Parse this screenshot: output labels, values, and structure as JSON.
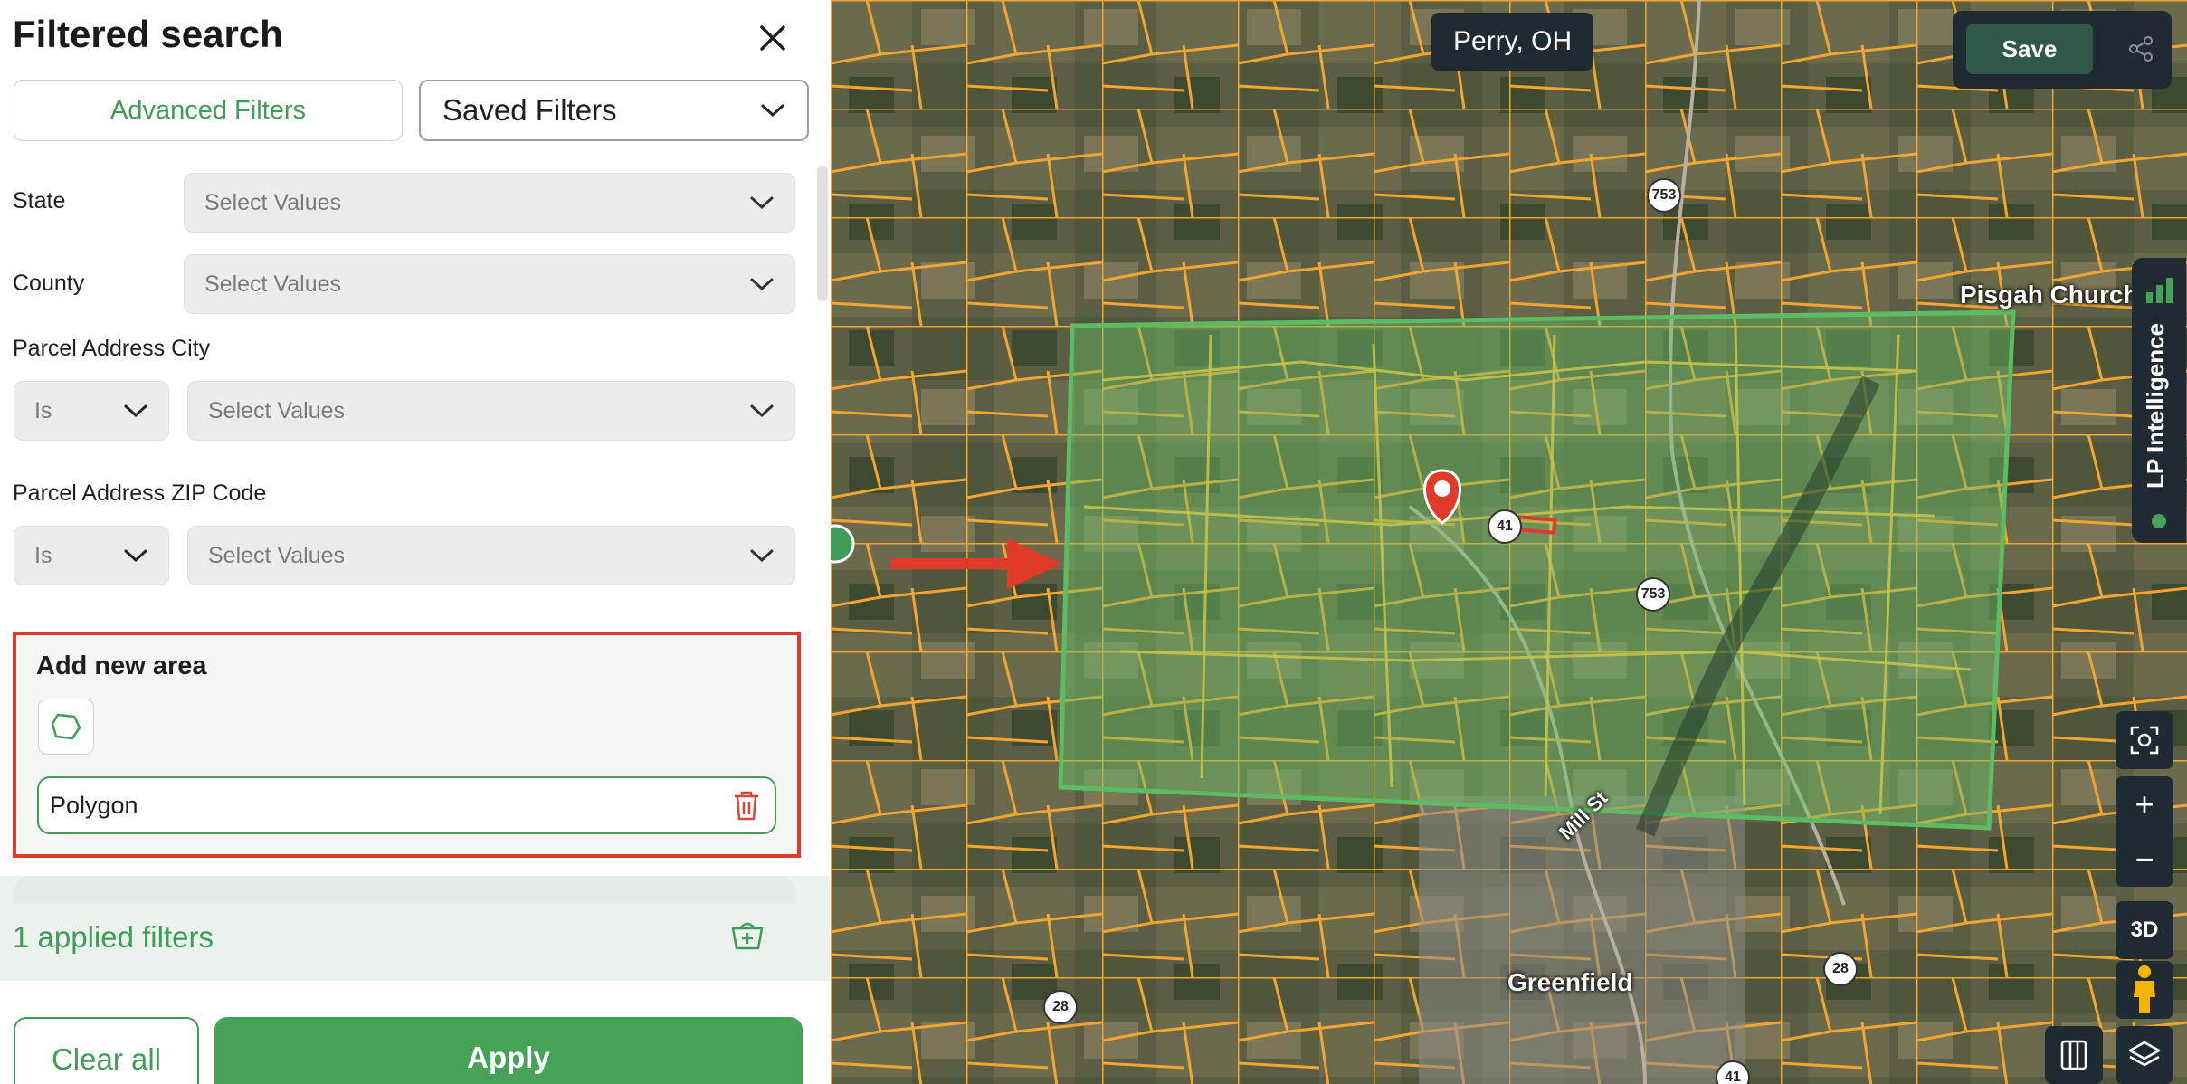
{
  "panel": {
    "title": "Filtered search",
    "advanced_filters": "Advanced Filters",
    "saved_filters": "Saved Filters",
    "state_label": "State",
    "state_placeholder": "Select Values",
    "county_label": "County",
    "county_placeholder": "Select Values",
    "city_label": "Parcel Address City",
    "city_operator": "Is",
    "city_placeholder": "Select Values",
    "zip_label": "Parcel Address ZIP Code",
    "zip_operator": "Is",
    "zip_placeholder": "Select Values",
    "area_title": "Add new area",
    "polygon_value": "Polygon",
    "applied_text": "1 applied filters",
    "clear_all": "Clear all",
    "apply": "Apply"
  },
  "map": {
    "location": "Perry, OH",
    "save": "Save",
    "lp_intelligence": "LP Intelligence",
    "btn_3d": "3D",
    "labels": {
      "pisgah": "Pisgah Church",
      "greenfield": "Greenfield",
      "mill_st": "Mill St"
    },
    "shields": [
      "753",
      "41",
      "753",
      "28",
      "28",
      "41"
    ],
    "icons": [
      "close-icon",
      "chevron-down-icon",
      "polygon-icon",
      "trash-icon",
      "filter-add-icon",
      "share-icon",
      "chart-icon",
      "scan-icon",
      "zoom-in-icon",
      "zoom-out-icon",
      "pegman-icon",
      "layers-icon",
      "split-view-icon",
      "map-pin-icon",
      "arrow-icon"
    ],
    "colors": {
      "parcel": "#f2a531",
      "selection": "#5dbb63",
      "accent": "#3f9d57",
      "highlight": "#e03b2a"
    }
  }
}
